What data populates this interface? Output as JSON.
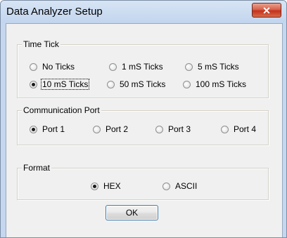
{
  "window": {
    "title": "Data Analyzer Setup",
    "close_glyph": "✕"
  },
  "time_tick": {
    "label": "Time Tick",
    "options": [
      "No Ticks",
      "1 mS Ticks",
      "5 mS Ticks",
      "10 mS Ticks",
      "50 mS Ticks",
      "100 mS Ticks"
    ],
    "selected": "10 mS Ticks"
  },
  "comm_port": {
    "label": "Communication Port",
    "options": [
      "Port 1",
      "Port 2",
      "Port 3",
      "Port 4"
    ],
    "selected": "Port 1"
  },
  "format": {
    "label": "Format",
    "options": [
      "HEX",
      "ASCII"
    ],
    "selected": "HEX"
  },
  "buttons": {
    "ok": "OK"
  },
  "colors": {
    "title_bar": "#c5d7ee",
    "close_button": "#c9432b",
    "dialog_bg": "#f0f0f0"
  }
}
